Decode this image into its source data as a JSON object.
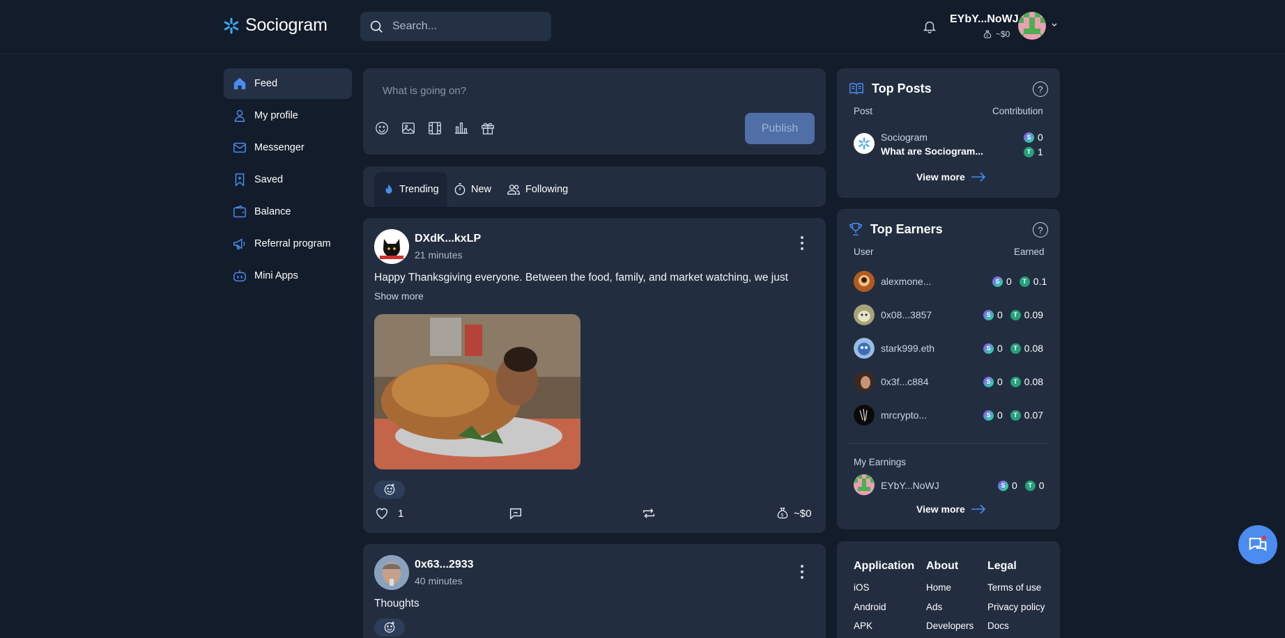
{
  "header": {
    "logo_text": "Sociogram",
    "search_placeholder": "Search...",
    "user_name": "EYbY...NoWJ",
    "user_balance": "~$0"
  },
  "sidebar": {
    "items": [
      {
        "label": "Feed",
        "icon": "home-icon",
        "active": true
      },
      {
        "label": "My profile",
        "icon": "user-icon"
      },
      {
        "label": "Messenger",
        "icon": "mail-icon"
      },
      {
        "label": "Saved",
        "icon": "bookmark-icon"
      },
      {
        "label": "Balance",
        "icon": "wallet-icon"
      },
      {
        "label": "Referral program",
        "icon": "megaphone-icon"
      },
      {
        "label": "Mini Apps",
        "icon": "robot-icon"
      }
    ]
  },
  "composer": {
    "placeholder": "What is going on?",
    "publish_label": "Publish"
  },
  "tabs": [
    {
      "label": "Trending",
      "icon": "flame-icon",
      "active": true
    },
    {
      "label": "New",
      "icon": "stopwatch-icon"
    },
    {
      "label": "Following",
      "icon": "users-icon"
    }
  ],
  "posts": [
    {
      "author": "DXdK...kxLP",
      "time": "21 minutes",
      "text": "Happy Thanksgiving everyone. Between the food, family, and market watching, we just",
      "show_more": "Show more",
      "likes": "1",
      "earnings": "~$0"
    },
    {
      "author": "0x63...2933",
      "time": "40 minutes",
      "text": "Thoughts"
    }
  ],
  "top_posts": {
    "title": "Top Posts",
    "col_post": "Post",
    "col_contribution": "Contribution",
    "item": {
      "author": "Sociogram",
      "title": "What are Sociogram...",
      "s_value": "0",
      "t_value": "1"
    },
    "view_more": "View more"
  },
  "top_earners": {
    "title": "Top Earners",
    "col_user": "User",
    "col_earned": "Earned",
    "rows": [
      {
        "name": "alexmone...",
        "s": "0",
        "t": "0.1"
      },
      {
        "name": "0x08...3857",
        "s": "0",
        "t": "0.09"
      },
      {
        "name": "stark999.eth",
        "s": "0",
        "t": "0.08"
      },
      {
        "name": "0x3f...c884",
        "s": "0",
        "t": "0.08"
      },
      {
        "name": "mrcrypto...",
        "s": "0",
        "t": "0.07"
      }
    ],
    "my_earnings_label": "My Earnings",
    "my": {
      "name": "EYbY...NoWJ",
      "s": "0",
      "t": "0"
    },
    "view_more": "View more"
  },
  "footer": {
    "columns": [
      {
        "heading": "Application",
        "links": [
          "iOS",
          "Android",
          "APK"
        ]
      },
      {
        "heading": "About",
        "links": [
          "Home",
          "Ads",
          "Developers"
        ]
      },
      {
        "heading": "Legal",
        "links": [
          "Terms of use",
          "Privacy policy",
          "Docs"
        ]
      }
    ]
  },
  "colors": {
    "accent": "#4a8cf0",
    "background": "#131c2a",
    "card": "#222e40"
  }
}
